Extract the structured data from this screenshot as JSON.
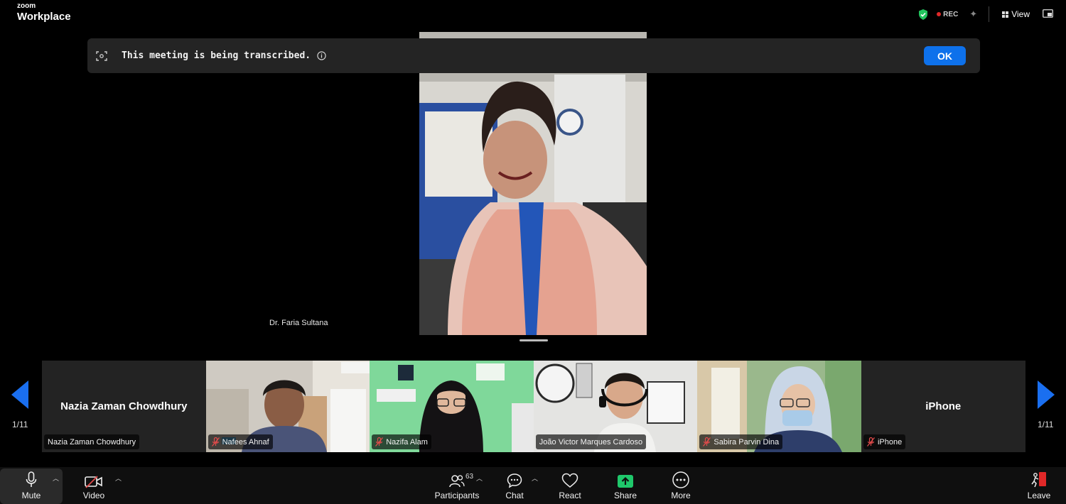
{
  "app": {
    "logo_small": "zoom",
    "logo_big": "Workplace"
  },
  "topbar": {
    "rec_label": "REC",
    "view_label": "View"
  },
  "banner": {
    "message": "This meeting is being transcribed.",
    "ok_label": "OK"
  },
  "speaker": {
    "name": "Dr. Faria Sultana"
  },
  "gallery": {
    "page_left": "1/11",
    "page_right": "1/11",
    "tiles": [
      {
        "center_name": "Nazia Zaman Chowdhury",
        "tag": "Nazia Zaman Chowdhury",
        "muted": false
      },
      {
        "tag": "Nafees Ahnaf",
        "muted": true
      },
      {
        "tag": "Nazifa Alam",
        "muted": true
      },
      {
        "tag": "João Victor Marques Cardoso",
        "muted": false
      },
      {
        "tag": "Sabira Parvin Dina",
        "muted": true
      },
      {
        "center_name": "iPhone",
        "tag": "iPhone",
        "muted": true
      }
    ]
  },
  "toolbar": {
    "mute": "Mute",
    "video": "Video",
    "participants": "Participants",
    "participants_count": "63",
    "chat": "Chat",
    "react": "React",
    "share": "Share",
    "more": "More",
    "leave": "Leave"
  },
  "colors": {
    "accent": "#0e71eb",
    "share_green": "#1fc86b",
    "leave_red": "#e02828",
    "banner_bg": "#242424"
  }
}
